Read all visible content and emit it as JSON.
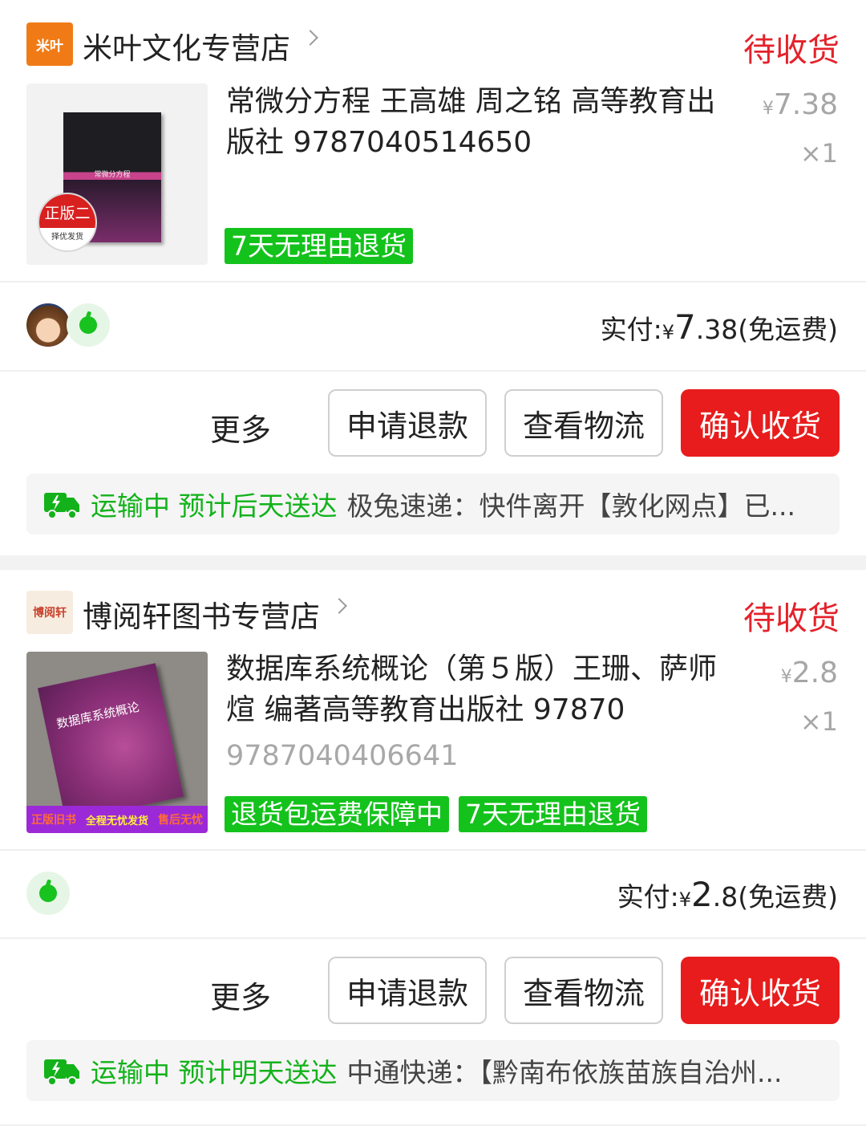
{
  "orders": [
    {
      "shop_logo": "米叶",
      "shop_name": "米叶文化专营店",
      "status": "待收货",
      "product_title": "常微分方程 王高雄 周之铭 高等教育出版社 9787040514650",
      "product_title_extra": "",
      "cover_title": "常微分方程",
      "cover_seal_top": "正版二手",
      "cover_seal_bottom": "择优发货",
      "price_currency": "¥",
      "price_value": "7.38",
      "quantity": "×1",
      "tags": [
        "7天无理由退货"
      ],
      "paid_label": "实付:",
      "paid_currency": "¥",
      "paid_int": "7",
      "paid_dec": ".38",
      "shipping_fee_note": "(免运费)",
      "more_label": "更多",
      "refund_label": "申请退款",
      "logistics_label": "查看物流",
      "confirm_label": "确认收货",
      "ship_status": "运输中 预计后天送达",
      "ship_detail": "极兔速递：快件离开【敦化网点】已..."
    },
    {
      "shop_logo": "博阅轩",
      "shop_name": "博阅轩图书专营店",
      "status": "待收货",
      "product_title": "数据库系统概论（第５版）王珊、萨师煊 编著高等教育出版社 97870",
      "product_title_extra": "9787040406641",
      "cover_title": "数据库系统概论",
      "cover_strip_left": "正版旧书",
      "cover_strip_mid": "全程无忧发货",
      "cover_strip_right": "售后无忧",
      "price_currency": "¥",
      "price_value": "2.8",
      "quantity": "×1",
      "tags": [
        "退货包运费保障中",
        "7天无理由退货"
      ],
      "paid_label": "实付:",
      "paid_currency": "¥",
      "paid_int": "2",
      "paid_dec": ".8",
      "shipping_fee_note": "(免运费)",
      "more_label": "更多",
      "refund_label": "申请退款",
      "logistics_label": "查看物流",
      "confirm_label": "确认收货",
      "ship_status": "运输中 预计明天送达",
      "ship_detail": "中通快递：【黔南布依族苗族自治州..."
    }
  ],
  "colors": {
    "accent_red": "#e81c1c",
    "status_red": "#e4222b",
    "tag_green": "#14c21c",
    "ship_green": "#13b21b"
  },
  "icons": [
    "chevron-right-icon",
    "truck-icon",
    "apple-icon"
  ]
}
